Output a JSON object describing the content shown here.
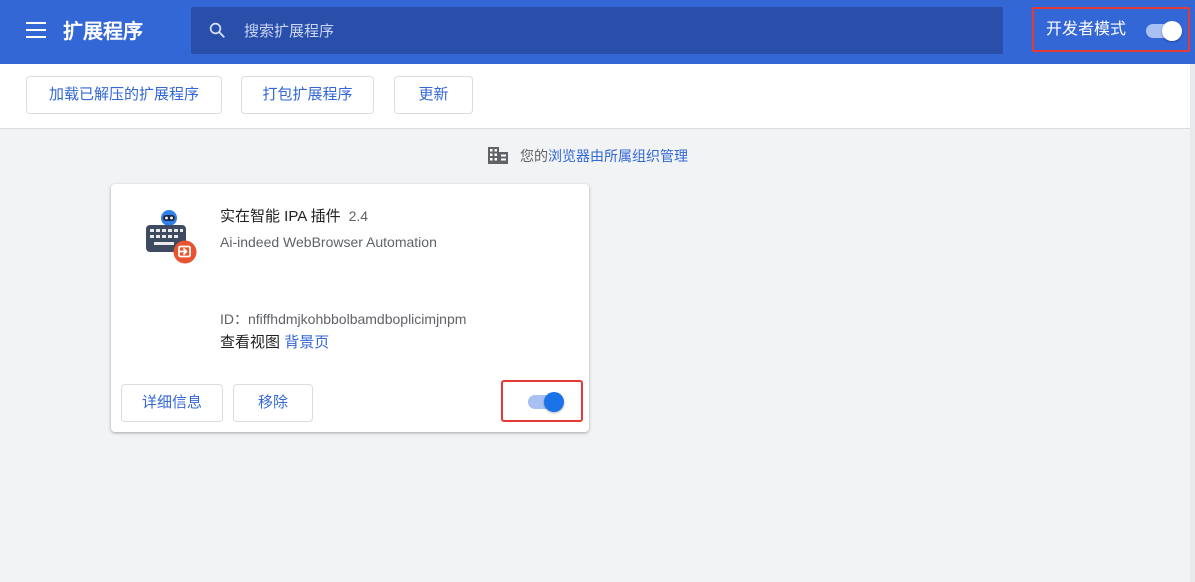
{
  "header": {
    "title": "扩展程序",
    "menu_icon": "hamburger-menu-icon",
    "search": {
      "placeholder": "搜索扩展程序",
      "value": "",
      "icon": "search-icon"
    },
    "developer_mode": {
      "label": "开发者模式",
      "enabled": true
    }
  },
  "toolbar": {
    "load_unpacked_label": "加载已解压的扩展程序",
    "pack_label": "打包扩展程序",
    "update_label": "更新"
  },
  "managed_notice": {
    "icon": "building-icon",
    "prefix": "您的",
    "link_text": "浏览器由所属组织管理"
  },
  "extensions": [
    {
      "name": "实在智能 IPA 插件",
      "version": "2.4",
      "description": "Ai-indeed WebBrowser Automation",
      "id_text": "ID：nfiffhdmjkohbbolbamdboplicimjnpm",
      "views_label": "查看视图",
      "views_link": "背景页",
      "details_label": "详细信息",
      "remove_label": "移除",
      "enabled": true,
      "icon": "ipa-robot-keyboard-icon"
    }
  ],
  "colors": {
    "header_bg": "#3367d6",
    "search_bg": "#2a4fab",
    "accent": "#1a73e8",
    "link": "#3367d6",
    "highlight_border": "#e53935",
    "page_bg": "#f1f3f4"
  }
}
